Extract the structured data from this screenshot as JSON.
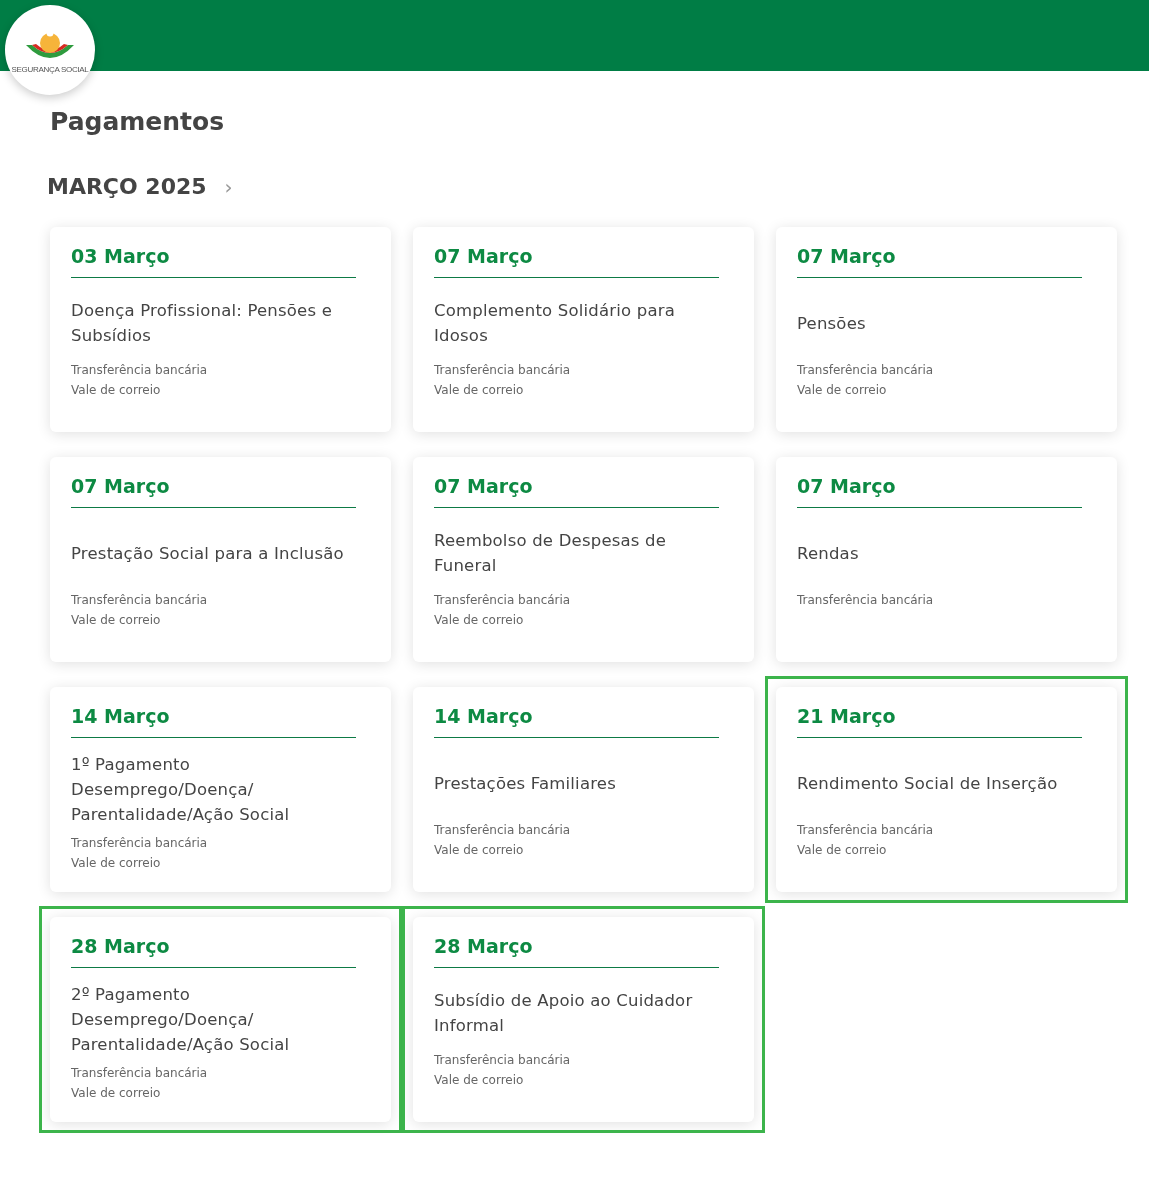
{
  "logo": {
    "text": "SEGURANÇA SOCIAL"
  },
  "page_title": "Pagamentos",
  "month": {
    "label": "MARÇO 2025",
    "next": "›"
  },
  "cards": [
    {
      "date": "03 Março",
      "title": "Doença Profissional: Pensões e Subsídios",
      "methods": [
        "Transferência bancária",
        "Vale de correio"
      ],
      "highlighted": false
    },
    {
      "date": "07 Março",
      "title": "Complemento Solidário para Idosos",
      "methods": [
        "Transferência bancária",
        "Vale de correio"
      ],
      "highlighted": false
    },
    {
      "date": "07 Março",
      "title": "Pensões",
      "methods": [
        "Transferência bancária",
        "Vale de correio"
      ],
      "highlighted": false
    },
    {
      "date": "07 Março",
      "title": "Prestação Social para a Inclusão",
      "methods": [
        "Transferência bancária",
        "Vale de correio"
      ],
      "highlighted": false
    },
    {
      "date": "07 Março",
      "title": "Reembolso de Despesas de Funeral",
      "methods": [
        "Transferência bancária",
        "Vale de correio"
      ],
      "highlighted": false
    },
    {
      "date": "07 Março",
      "title": "Rendas",
      "methods": [
        "Transferência bancária"
      ],
      "highlighted": false
    },
    {
      "date": "14 Março",
      "title": "1º Pagamento Desemprego/Doença/ Parentalidade/Ação Social",
      "methods": [
        "Transferência bancária",
        "Vale de correio"
      ],
      "highlighted": false
    },
    {
      "date": "14 Março",
      "title": "Prestações Familiares",
      "methods": [
        "Transferência bancária",
        "Vale de correio"
      ],
      "highlighted": false
    },
    {
      "date": "21 Março",
      "title": "Rendimento Social de Inserção",
      "methods": [
        "Transferência bancária",
        "Vale de correio"
      ],
      "highlighted": true
    },
    {
      "date": "28 Março",
      "title": "2º Pagamento Desemprego/Doença/ Parentalidade/Ação Social",
      "methods": [
        "Transferência bancária",
        "Vale de correio"
      ],
      "highlighted": true
    },
    {
      "date": "28 Março",
      "title": "Subsídio de Apoio ao Cuidador Informal",
      "methods": [
        "Transferência bancária",
        "Vale de correio"
      ],
      "highlighted": true
    }
  ]
}
